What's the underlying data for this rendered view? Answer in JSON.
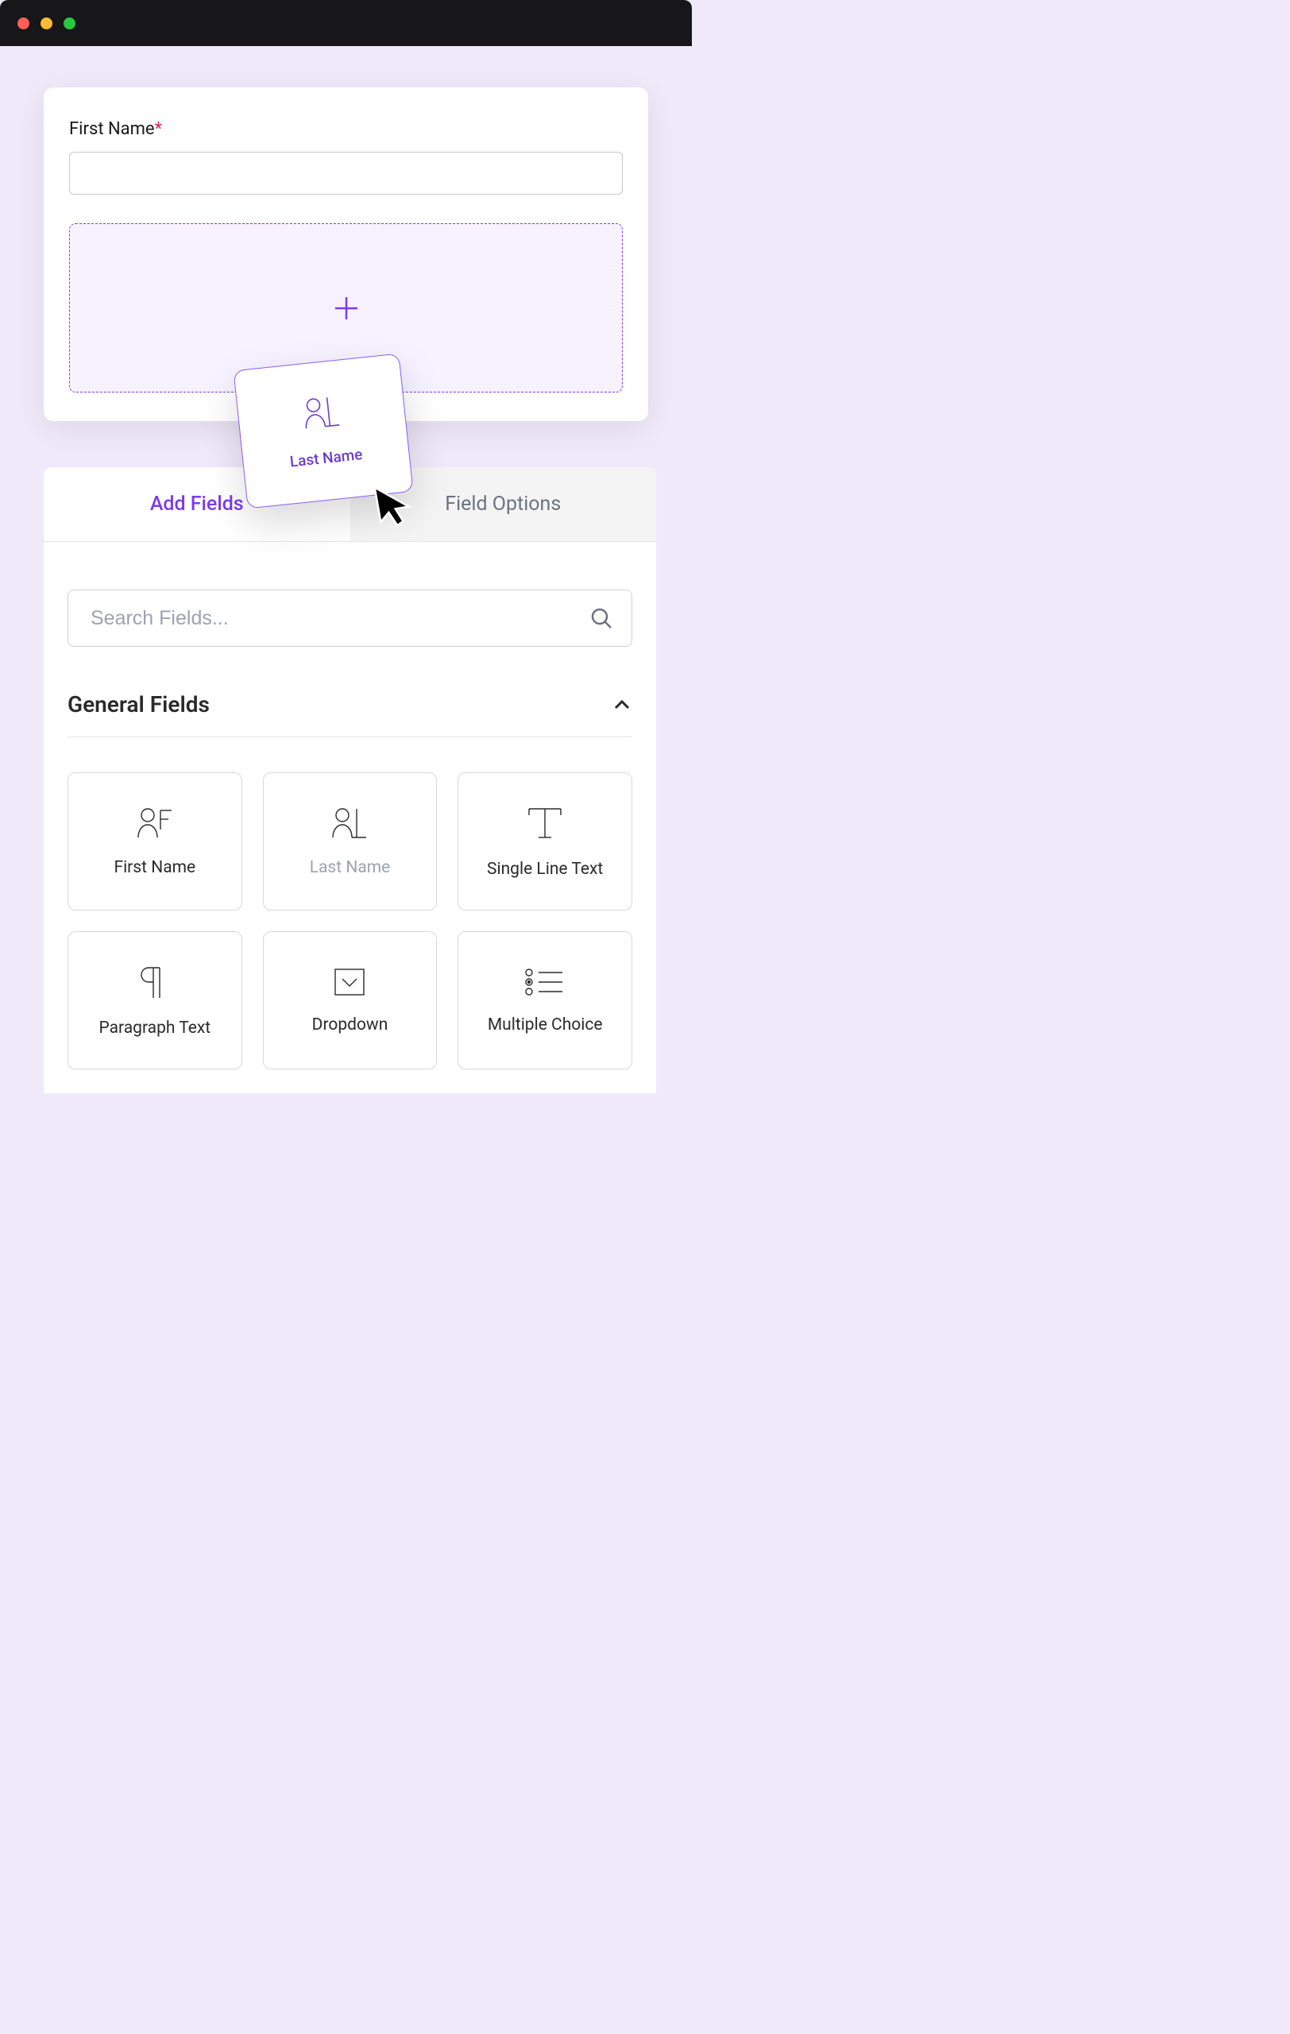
{
  "form": {
    "field_label": "First Name",
    "required_marker": "*"
  },
  "dragging": {
    "label": "Last Name"
  },
  "panel": {
    "tabs": {
      "add_fields": "Add Fields",
      "field_options": "Field Options"
    },
    "search": {
      "placeholder": "Search Fields..."
    },
    "section_title": "General Fields",
    "fields": [
      {
        "label": "First Name",
        "icon": "user-f"
      },
      {
        "label": "Last Name",
        "icon": "user-l"
      },
      {
        "label": "Single Line Text",
        "icon": "text-t"
      },
      {
        "label": "Paragraph Text",
        "icon": "pilcrow"
      },
      {
        "label": "Dropdown",
        "icon": "dropdown"
      },
      {
        "label": "Multiple Choice",
        "icon": "list-radio"
      }
    ]
  },
  "colors": {
    "accent": "#7c3aed",
    "accent_bg": "#f6f2ff",
    "required": "#e31b54"
  }
}
